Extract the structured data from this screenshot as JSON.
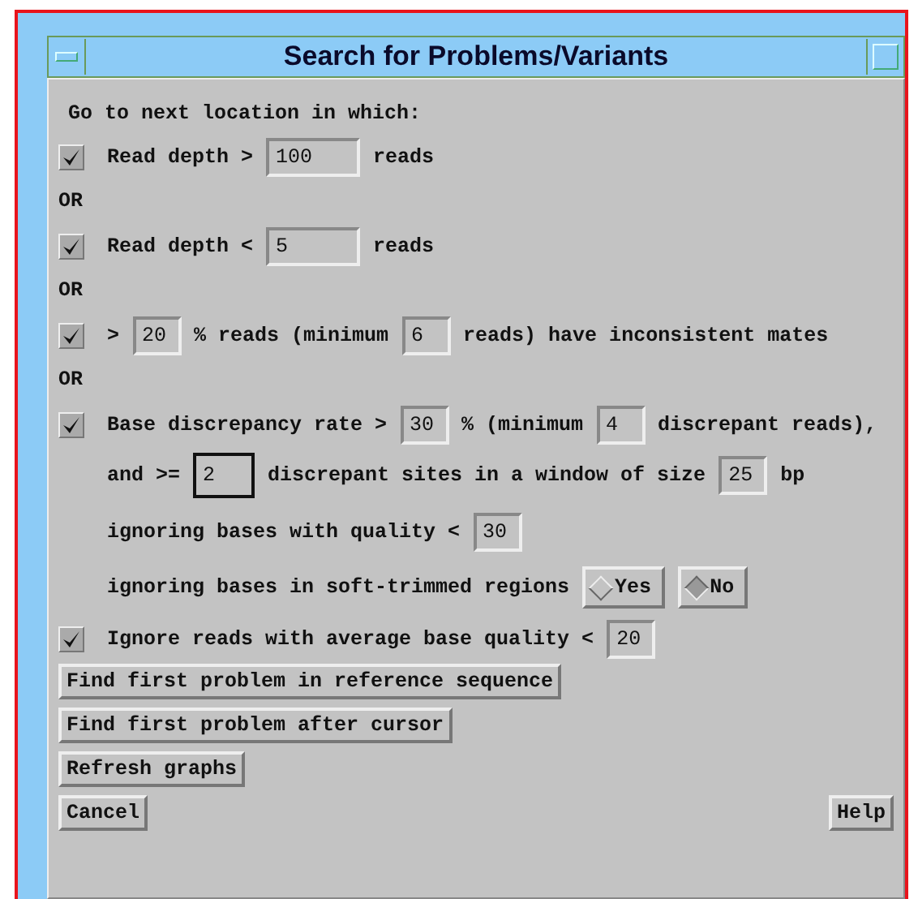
{
  "window": {
    "title": "Search for Problems/Variants"
  },
  "rows": [
    {
      "kind": "heading",
      "parts": [
        {
          "kind": "text",
          "text": "Go to next location in which:"
        }
      ]
    },
    {
      "kind": "check",
      "checked": true,
      "parts": [
        {
          "kind": "text",
          "text": "Read depth >"
        },
        {
          "kind": "field",
          "value": "100",
          "focused": false
        },
        {
          "kind": "text",
          "text": "reads"
        }
      ]
    },
    {
      "kind": "or",
      "parts": [
        {
          "kind": "text",
          "text": "OR"
        }
      ]
    },
    {
      "kind": "check",
      "checked": true,
      "parts": [
        {
          "kind": "text",
          "text": "Read depth <"
        },
        {
          "kind": "field",
          "value": "5",
          "focused": false
        },
        {
          "kind": "text",
          "text": "reads"
        }
      ]
    },
    {
      "kind": "or",
      "parts": [
        {
          "kind": "text",
          "text": "OR"
        }
      ]
    },
    {
      "kind": "check",
      "checked": true,
      "parts": [
        {
          "kind": "text",
          "text": ">"
        },
        {
          "kind": "small",
          "value": "20",
          "focused": false
        },
        {
          "kind": "text",
          "text": "% reads (minimum"
        },
        {
          "kind": "small",
          "value": "6",
          "focused": false
        },
        {
          "kind": "text",
          "text": "reads) have inconsistent mates"
        }
      ]
    },
    {
      "kind": "or",
      "parts": [
        {
          "kind": "text",
          "text": "OR"
        }
      ]
    },
    {
      "kind": "check",
      "checked": true,
      "parts": [
        {
          "kind": "text",
          "text": "Base discrepancy rate >"
        },
        {
          "kind": "small",
          "value": "30",
          "focused": false
        },
        {
          "kind": "text",
          "text": "% (minimum"
        },
        {
          "kind": "small",
          "value": "4",
          "focused": false
        },
        {
          "kind": "text",
          "text": "discrepant reads),"
        }
      ]
    },
    {
      "kind": "indent",
      "parts": [
        {
          "kind": "text",
          "text": "and >="
        },
        {
          "kind": "small",
          "value": "2",
          "focused": true
        },
        {
          "kind": "text",
          "text": "discrepant sites in a window of size"
        },
        {
          "kind": "small",
          "value": "25",
          "focused": false
        },
        {
          "kind": "text",
          "text": "bp"
        }
      ]
    },
    {
      "kind": "indent",
      "parts": [
        {
          "kind": "text",
          "text": "ignoring bases with quality <"
        },
        {
          "kind": "small",
          "value": "30",
          "focused": false
        }
      ]
    },
    {
      "kind": "indent",
      "parts": [
        {
          "kind": "text",
          "text": "ignoring bases in soft-trimmed regions"
        },
        {
          "kind": "radio",
          "label": "Yes",
          "selected": false
        },
        {
          "kind": "radio",
          "label": "No",
          "selected": true
        }
      ]
    },
    {
      "kind": "check",
      "checked": true,
      "parts": [
        {
          "kind": "text",
          "text": "Ignore reads with average base quality <"
        },
        {
          "kind": "small",
          "value": "20",
          "focused": false
        }
      ]
    }
  ],
  "buttons": [
    {
      "label": "Find first problem in reference sequence"
    },
    {
      "label": "Find first problem after cursor"
    },
    {
      "label": "Refresh graphs"
    }
  ],
  "footer_buttons": [
    {
      "label": "Cancel"
    },
    {
      "label": "Help"
    }
  ]
}
